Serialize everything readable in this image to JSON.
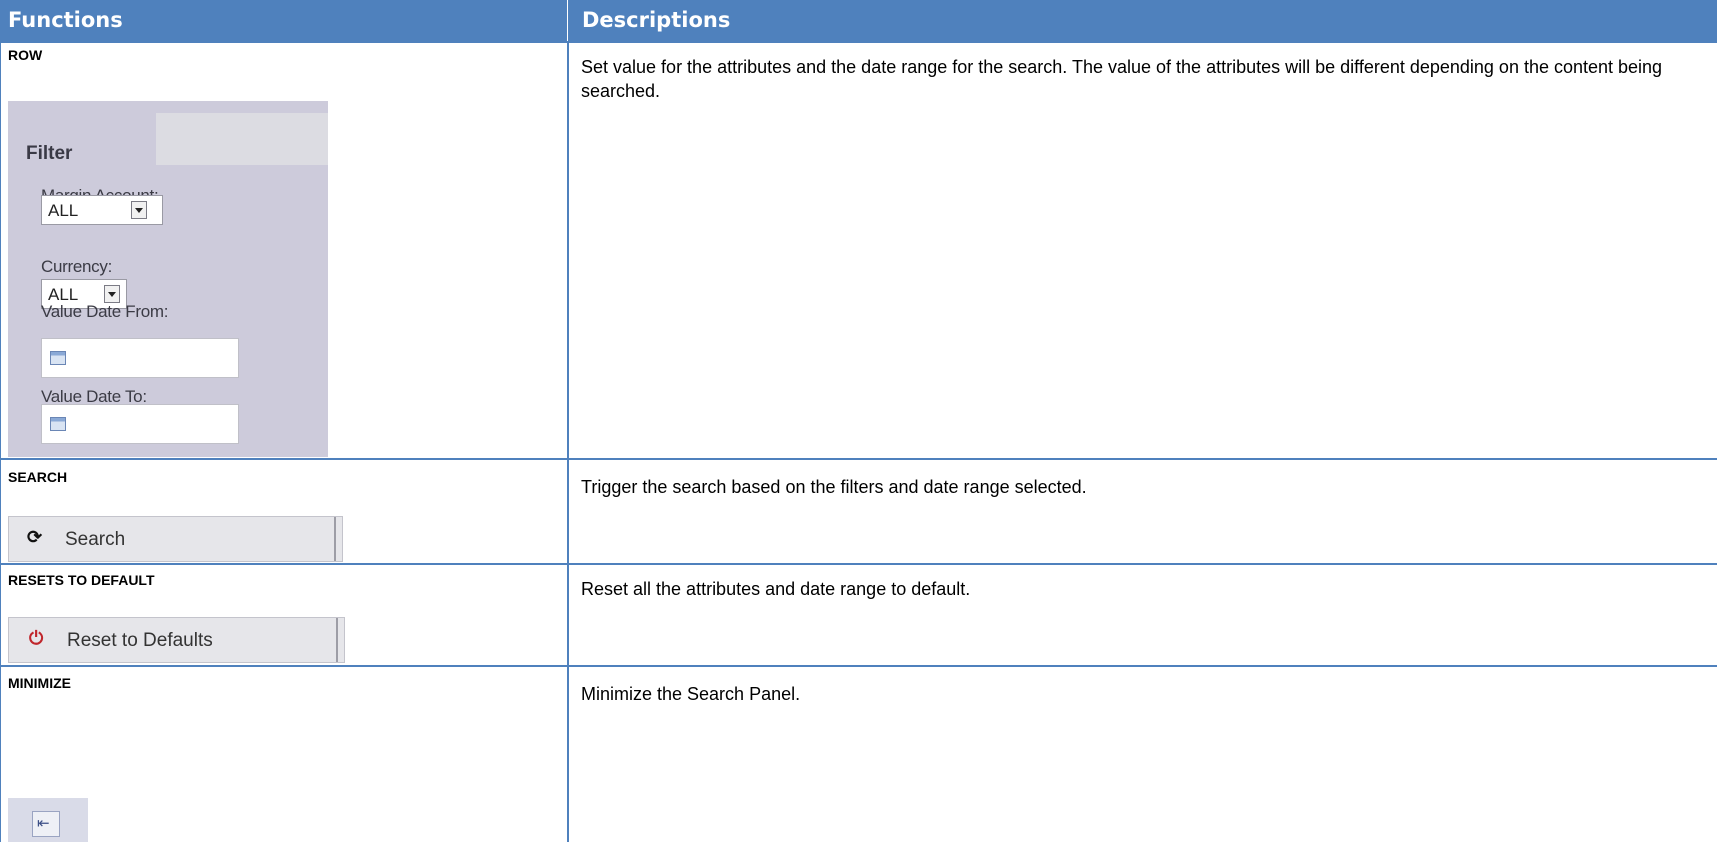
{
  "header": {
    "functions": "Functions",
    "descriptions": "Descriptions"
  },
  "rows": [
    {
      "function": "ROW",
      "description": "Set value for the attributes and the date range for the search. The value of the attributes will be different depending on the content being searched."
    },
    {
      "function": "SEARCH",
      "description": "Trigger the search based on the filters and date range selected."
    },
    {
      "function": "RESETS TO DEFAULT",
      "description": "Reset all the attributes and date range to default."
    },
    {
      "function": "MINIMIZE",
      "description": "Minimize the Search Panel."
    }
  ],
  "filter": {
    "title": "Filter",
    "margin_account_label": "Margin Account:",
    "margin_account_value": "ALL",
    "currency_label": "Currency:",
    "currency_value": "ALL",
    "value_date_from_label": "Value Date From:",
    "value_date_to_label": "Value Date To:"
  },
  "buttons": {
    "search_label": "Search",
    "reset_label": "Reset to Defaults"
  },
  "colors": {
    "header_bg": "#4f81bd",
    "reset_icon": "#c0262c"
  }
}
